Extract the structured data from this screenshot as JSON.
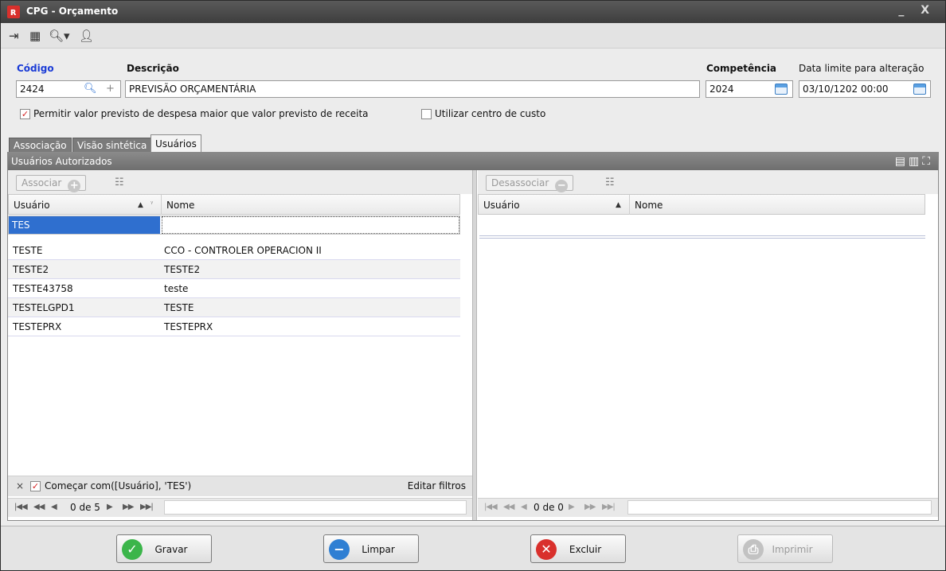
{
  "window": {
    "title": "CPG - Orçamento",
    "controls": "_ X"
  },
  "toolbar": {
    "icons": [
      "exit-icon",
      "preview-icon",
      "search-icon",
      "user-icon"
    ]
  },
  "form": {
    "codigo_label": "Código",
    "codigo_value": "2424",
    "descricao_label": "Descrição",
    "descricao_value": "PREVISÃO ORÇAMENTÁRIA",
    "competencia_label": "Competência",
    "competencia_value": "2024",
    "data_limite_label": "Data limite para alteração",
    "data_limite_value": "03/10/1202 00:00",
    "permitir_label": "Permitir valor  previsto de despesa maior que valor previsto de receita",
    "permitir_checked": true,
    "centro_custo_label": "Utilizar centro de custo",
    "centro_custo_checked": false
  },
  "tabs": [
    {
      "label": "Associação",
      "active": false
    },
    {
      "label": "Visão sintética",
      "active": false
    },
    {
      "label": "Usuários",
      "active": true
    }
  ],
  "panel": {
    "title": "Usuários Autorizados",
    "left": {
      "associar_label": "Associar",
      "columns": [
        "Usuário",
        "Nome"
      ],
      "filter_value": "TES",
      "rows": [
        {
          "usuario": "TESTE",
          "nome": "CCO - CONTROLER OPERACION II"
        },
        {
          "usuario": "TESTE2",
          "nome": "TESTE2"
        },
        {
          "usuario": "TESTE43758",
          "nome": "teste"
        },
        {
          "usuario": "TESTELGPD1",
          "nome": "TESTE"
        },
        {
          "usuario": "TESTEPRX",
          "nome": "TESTEPRX"
        }
      ],
      "filter_text": "Começar com([Usuário], 'TES')",
      "filter_close": "×",
      "edit_filters": "Editar filtros",
      "nav_text": "0 de 5"
    },
    "right": {
      "desassociar_label": "Desassociar",
      "columns": [
        "Usuário",
        "Nome"
      ],
      "nav_text": "0 de 0"
    }
  },
  "footer": {
    "gravar": "Gravar",
    "limpar": "Limpar",
    "excluir": "Excluir",
    "imprimir": "Imprimir"
  },
  "colors": {
    "accent_blue": "#1a3bd6",
    "gravar_green": "#3bb54a",
    "limpar_blue": "#2f7fd3",
    "excluir_red": "#d9302c"
  }
}
